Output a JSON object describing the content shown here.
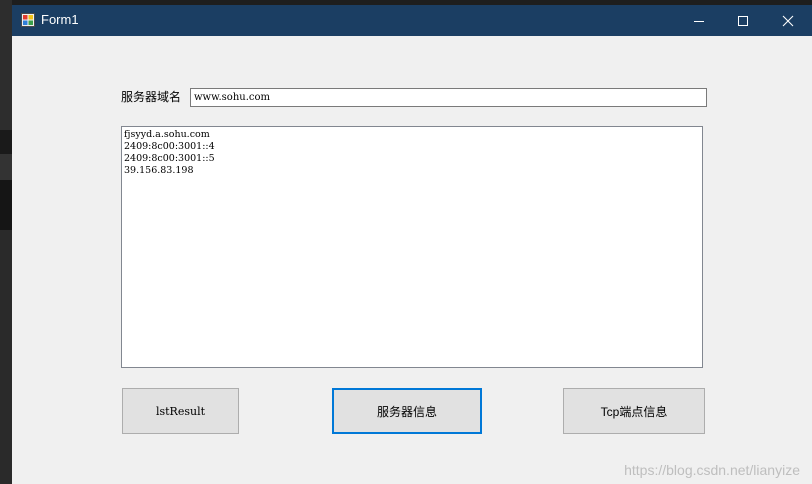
{
  "window": {
    "title": "Form1"
  },
  "form": {
    "domain_label": "服务器域名",
    "domain_value": "www.sohu.com",
    "results": [
      "fjsyyd.a.sohu.com",
      "2409:8c00:3001::4",
      "2409:8c00:3001::5",
      "39.156.83.198"
    ]
  },
  "buttons": {
    "lst_result": "lstResult",
    "server_info": "服务器信息",
    "tcp_info": "Tcp端点信息"
  },
  "watermark": "https://blog.csdn.net/lianyize",
  "colors": {
    "titlebar": "#1b3e63",
    "window_bg": "#f0f0f0",
    "focus_border": "#0078d7"
  }
}
